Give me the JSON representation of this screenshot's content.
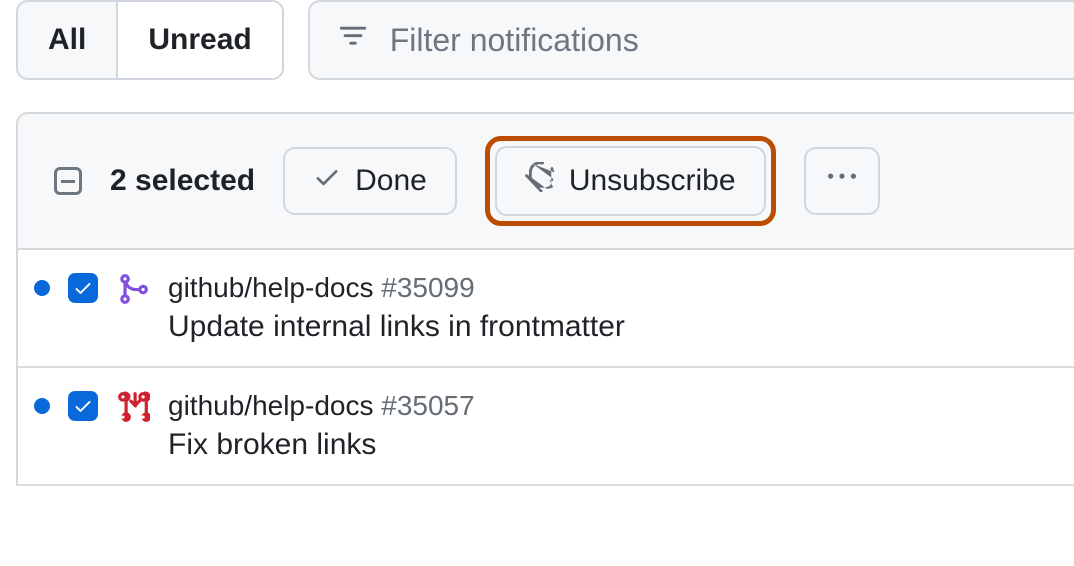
{
  "tabs": {
    "all": "All",
    "unread": "Unread"
  },
  "filter": {
    "placeholder": "Filter notifications"
  },
  "bulk": {
    "selected_label": "2 selected",
    "done": "Done",
    "unsubscribe": "Unsubscribe"
  },
  "rows": [
    {
      "repo": "github/help-docs",
      "number": "#35099",
      "title": "Update internal links in frontmatter",
      "kind": "merged"
    },
    {
      "repo": "github/help-docs",
      "number": "#35057",
      "title": "Fix broken links",
      "kind": "pr"
    }
  ]
}
